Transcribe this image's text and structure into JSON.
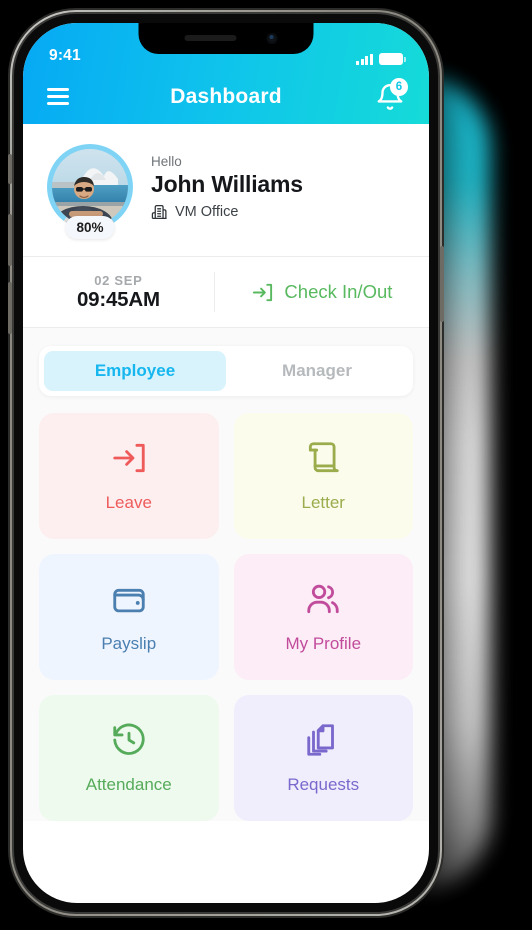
{
  "status_bar": {
    "time": "9:41",
    "signal_icon": "signal-bars-icon",
    "battery_icon": "battery-icon"
  },
  "nav": {
    "menu_icon": "hamburger-menu-icon",
    "title": "Dashboard",
    "bell_icon": "notification-bell-icon",
    "badge_count": "6"
  },
  "profile": {
    "greeting": "Hello",
    "name": "John Williams",
    "org": "VM Office",
    "org_icon": "building-icon",
    "completion": "80%",
    "completion_value": 80,
    "avatar_alt": "man-at-sydney-opera-house-photo"
  },
  "check_in": {
    "date": "02 SEP",
    "time": "09:45AM",
    "action_label": "Check In/Out",
    "action_icon": "login-arrow-icon",
    "action_color": "#58b95f"
  },
  "tabs": [
    {
      "label": "Employee",
      "active": true
    },
    {
      "label": "Manager",
      "active": false
    }
  ],
  "cards": [
    {
      "label": "Leave",
      "icon": "login-arrow-icon",
      "bg": "#fdeff0",
      "fg": "#ef5b5b"
    },
    {
      "label": "Letter",
      "icon": "scroll-icon",
      "bg": "#fbfcec",
      "fg": "#9aac4c"
    },
    {
      "label": "Payslip",
      "icon": "wallet-icon",
      "bg": "#eff5fe",
      "fg": "#4a7fb0"
    },
    {
      "label": "My Profile",
      "icon": "people-icon",
      "bg": "#fcedf6",
      "fg": "#c24c9c"
    },
    {
      "label": "Attendance",
      "icon": "clock-history-icon",
      "bg": "#eefaee",
      "fg": "#56ab5b"
    },
    {
      "label": "Requests",
      "icon": "copy-documents-icon",
      "bg": "#f0eefc",
      "fg": "#7b68cc"
    }
  ],
  "theme": {
    "header_from": "#06a9f4",
    "header_to": "#15dbd8",
    "tab_active_bg": "#d9f3fd",
    "tab_active_fg": "#16b7ef",
    "ring_color": "#7fd4f5"
  }
}
